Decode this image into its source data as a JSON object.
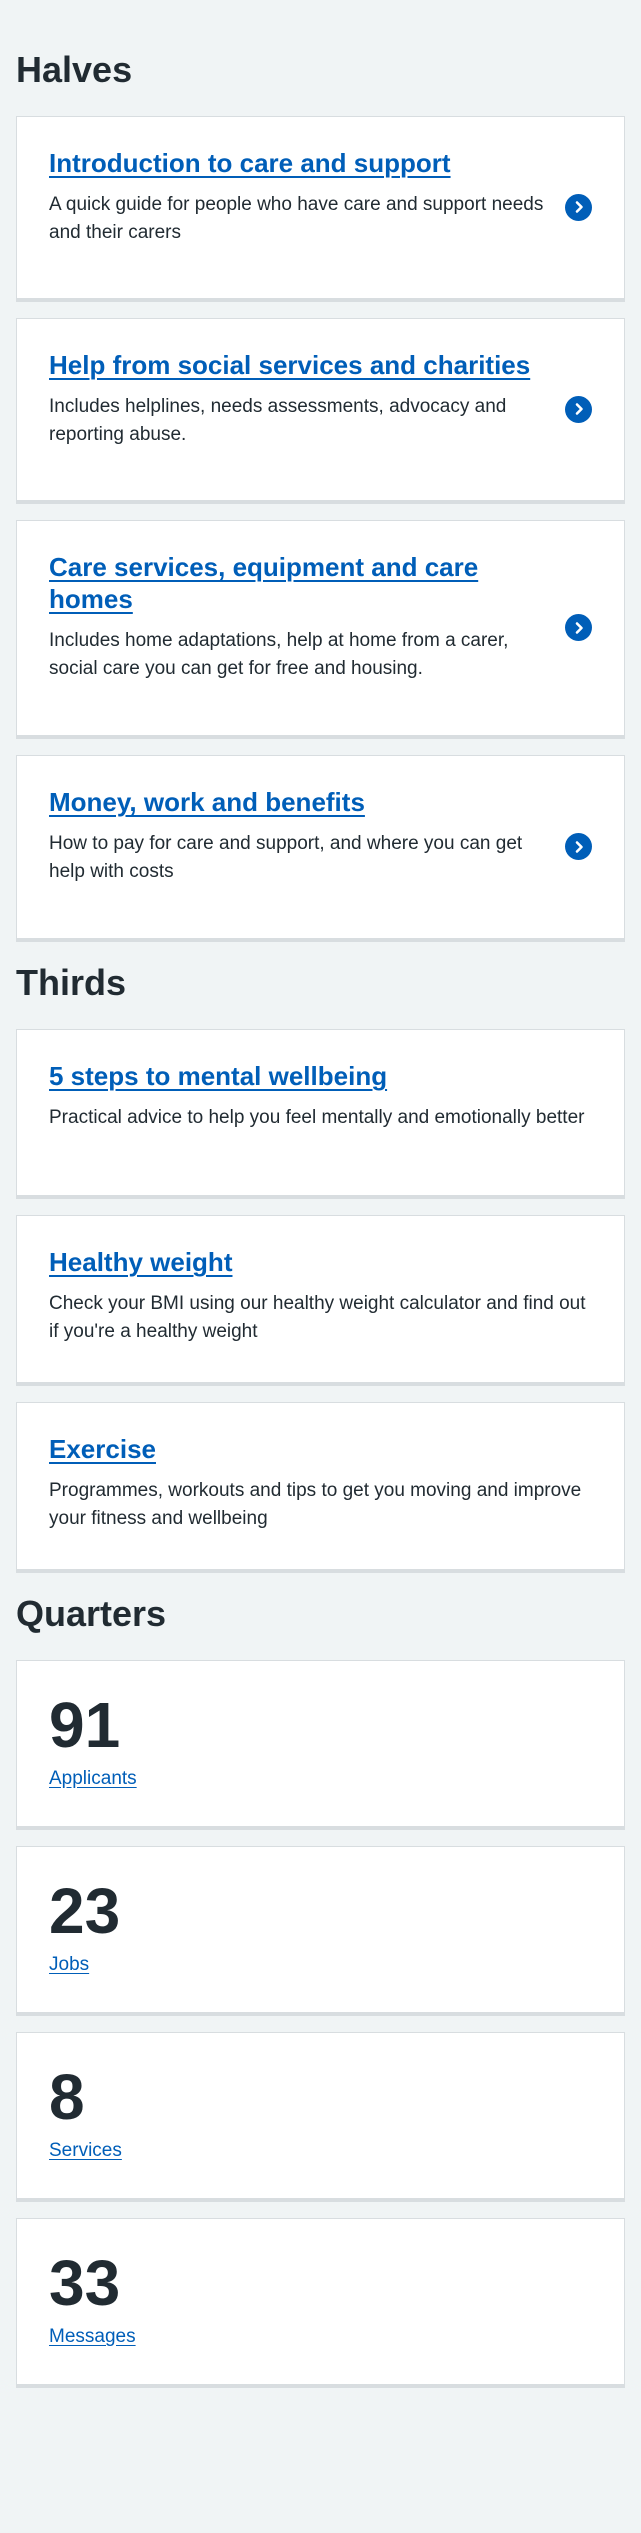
{
  "halves": {
    "heading": "Halves",
    "cards": [
      {
        "title": "Introduction to care and support",
        "description": "A quick guide for people who have care and support needs and their carers"
      },
      {
        "title": "Help from social services and charities",
        "description": "Includes helplines, needs assessments, advocacy and reporting abuse."
      },
      {
        "title": "Care services, equipment and care homes",
        "description": "Includes home adaptations, help at home from a carer, social care you can get for free and housing."
      },
      {
        "title": "Money, work and benefits",
        "description": "How to pay for care and support, and where you can get help with costs"
      }
    ],
    "chevron_icon": "chevron-right-circle-icon",
    "accent_color": "#005eb8"
  },
  "thirds": {
    "heading": "Thirds",
    "cards": [
      {
        "title": "5 steps to mental wellbeing",
        "description": "Practical advice to help you feel mentally and emotionally better"
      },
      {
        "title": "Healthy weight",
        "description": "Check your BMI using our healthy weight calculator and find out if you're a healthy weight"
      },
      {
        "title": "Exercise",
        "description": "Programmes, workouts and tips to get you moving and improve your fitness and wellbeing"
      }
    ]
  },
  "quarters": {
    "heading": "Quarters",
    "stats": [
      {
        "number": "91",
        "label": "Applicants"
      },
      {
        "number": "23",
        "label": "Jobs"
      },
      {
        "number": "8",
        "label": "Services"
      },
      {
        "number": "33",
        "label": "Messages"
      }
    ]
  }
}
